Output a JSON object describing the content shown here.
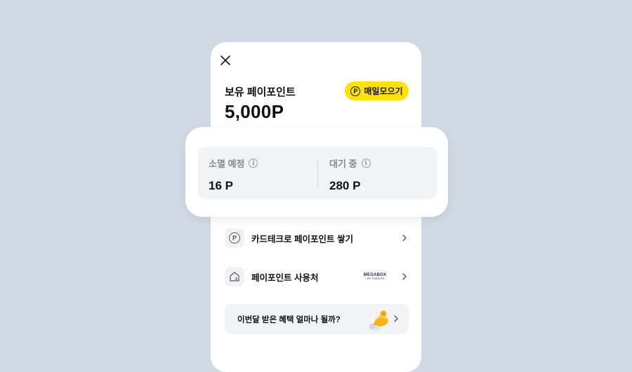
{
  "header": {
    "close_icon": "close-icon",
    "points_label": "보유 페이포인트",
    "points_value": "5,000P",
    "daily_button": {
      "label": "매일모으기",
      "icon": "P"
    }
  },
  "summary": {
    "expiring": {
      "label": "소멸 예정",
      "value": "16 P",
      "info_icon": "i"
    },
    "pending": {
      "label": "대기 중",
      "value": "280 P",
      "info_icon": "i"
    }
  },
  "menu": {
    "items": [
      {
        "label": "카드테크로 페이포인트 쌓기",
        "icon": "P"
      },
      {
        "label": "페이포인트 사용처",
        "icon": "store-icon",
        "brand_top": "MEGABOX",
        "brand_bottom": "LIFE THEATER"
      }
    ]
  },
  "banner": {
    "text": "이번달 받은 혜택 얼마나 될까?"
  },
  "colors": {
    "background": "#d1dae4",
    "accent": "#ffe300",
    "card": "#ffffff",
    "panel": "#f2f3f5"
  }
}
